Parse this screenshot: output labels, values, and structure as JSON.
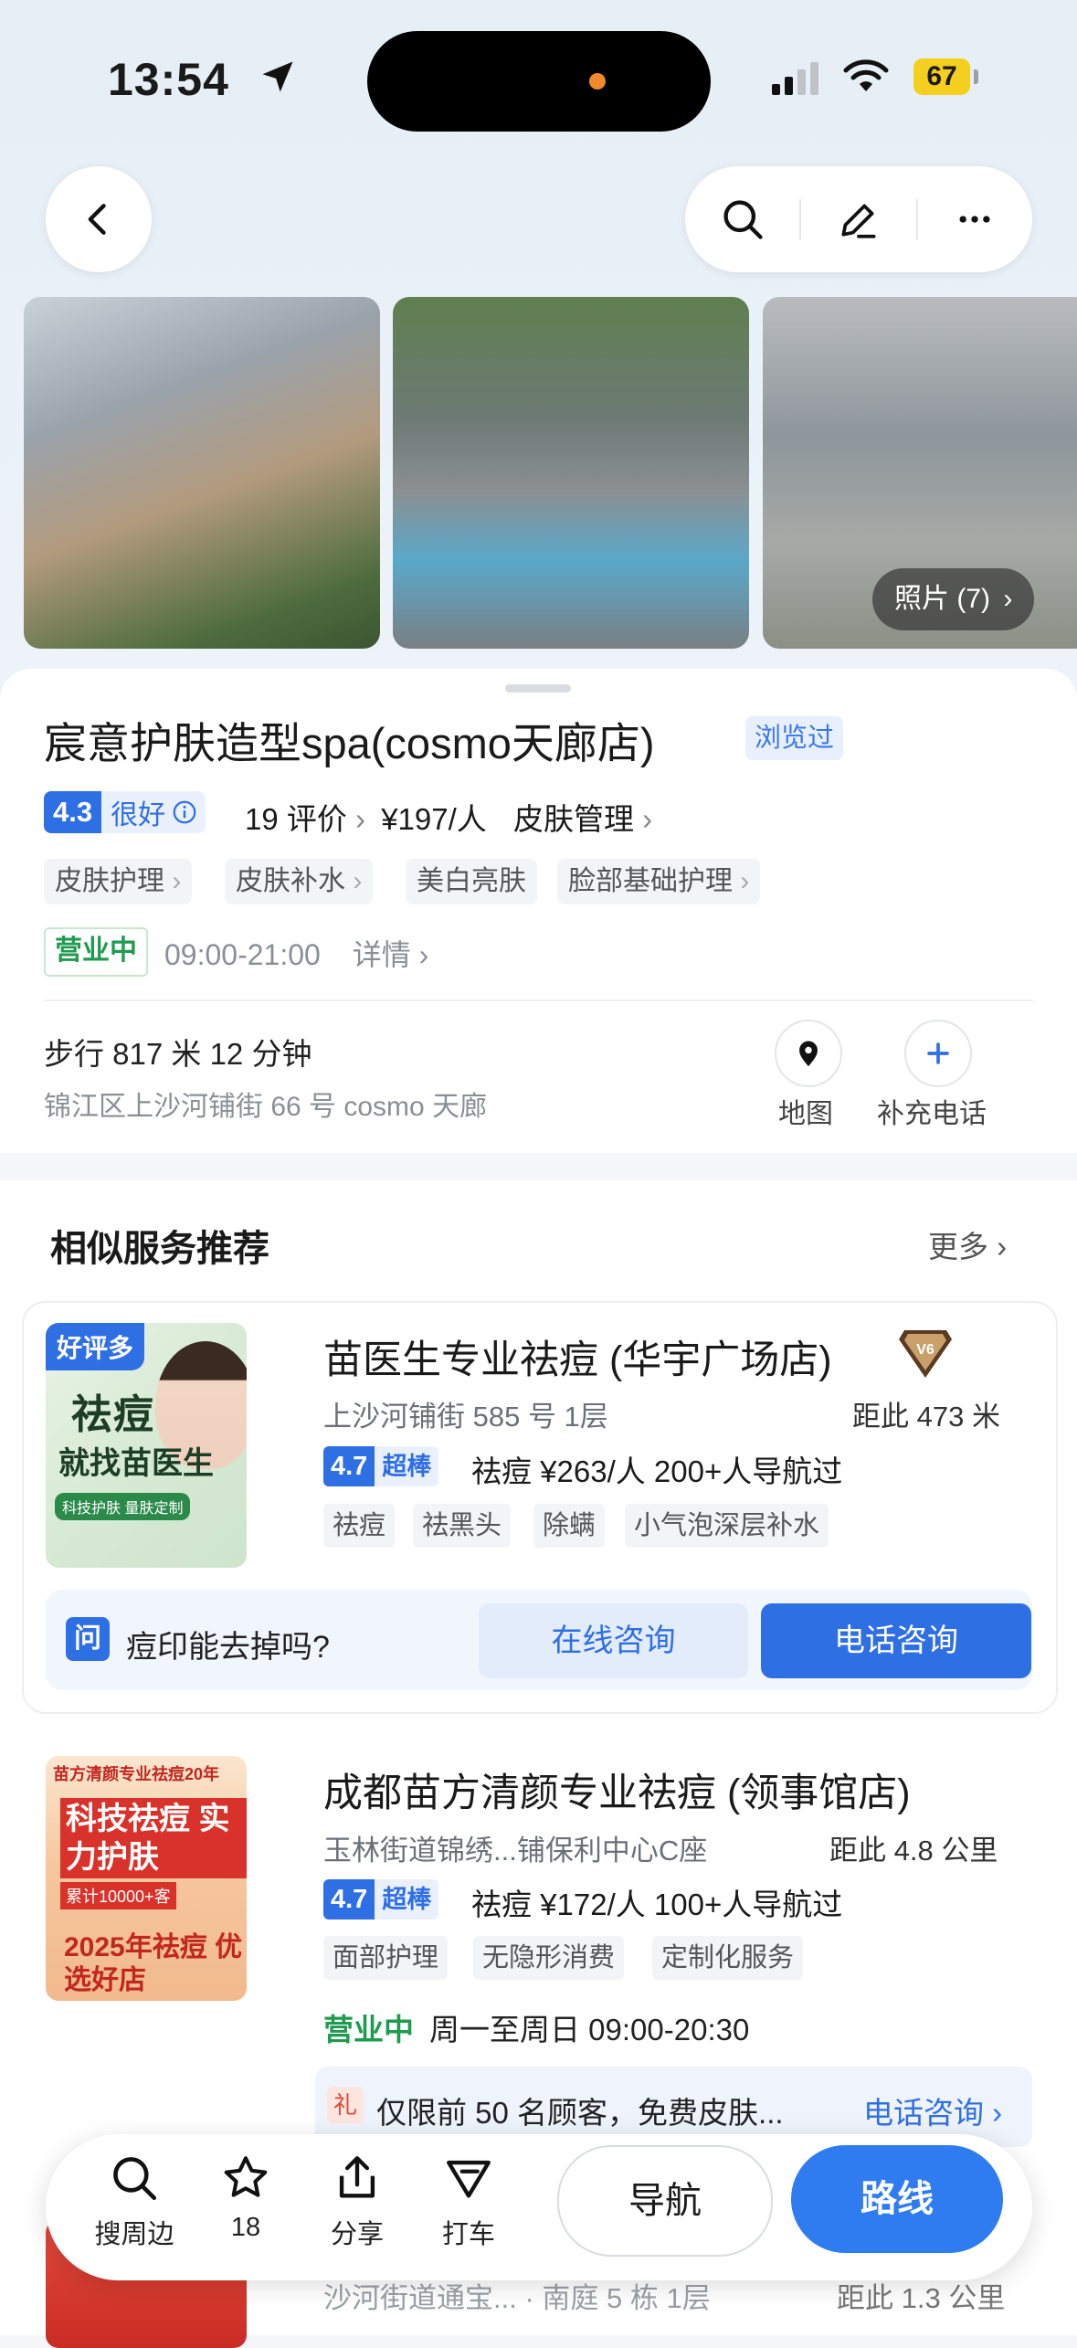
{
  "status_bar": {
    "time": "13:54",
    "battery": "67"
  },
  "photos": {
    "count_label": "照片 (7)"
  },
  "place": {
    "title": "宸意护肤造型spa(cosmo天廊店)",
    "viewed_badge": "浏览过",
    "rating": "4.3",
    "rating_label": "很好",
    "reviews": "19 评价",
    "price": "¥197/人",
    "category": "皮肤管理",
    "tags": [
      "皮肤护理",
      "皮肤补水",
      "美白亮肤",
      "脸部基础护理"
    ],
    "open_status": "营业中",
    "hours": "09:00-21:00",
    "details_link": "详情",
    "walk_info": "步行 817 米 12 分钟",
    "address": "锦江区上沙河铺街 66 号 cosmo 天廊",
    "map_label": "地图",
    "add_phone_label": "补充电话"
  },
  "similar": {
    "section_title": "相似服务推荐",
    "more_label": "更多",
    "items": [
      {
        "badge": "好评多",
        "thumb_line1": "祛痘",
        "thumb_line2": "就找苗医生",
        "thumb_line3": "科技护肤  量肤定制",
        "name": "苗医生专业祛痘 (华宇广场店)",
        "vip": "V6",
        "address": "上沙河铺街 585 号 1层",
        "distance": "距此 473 米",
        "rating": "4.7",
        "rating_label": "超棒",
        "meta": "祛痘  ¥263/人  200+人导航过",
        "tags": [
          "祛痘",
          "祛黑头",
          "除螨",
          "小气泡深层补水"
        ],
        "qa_icon": "问",
        "qa_question": "痘印能去掉吗?",
        "qa_online": "在线咨询",
        "qa_phone": "电话咨询"
      },
      {
        "thumb_line1": "苗方清颜专业祛痘20年",
        "thumb_line2": "科技祛痘 实力护肤",
        "thumb_line3": "累计10000+客",
        "thumb_line4": "2025年祛痘 优选好店",
        "name": "成都苗方清颜专业祛痘 (领事馆店)",
        "address": "玉林街道锦绣...铺保利中心C座",
        "distance": "距此 4.8 公里",
        "rating": "4.7",
        "rating_label": "超棒",
        "meta": "祛痘  ¥172/人  100+人导航过",
        "tags": [
          "面部护理",
          "无隐形消费",
          "定制化服务"
        ],
        "open_status": "营业中",
        "hours": "周一至周日 09:00-20:30",
        "promo_icon": "礼",
        "promo_text": "仅限前 50 名顾客，免费皮肤...",
        "promo_link": "电话咨询"
      },
      {
        "address": "沙河街道通宝... · 南庭 5 栋 1层",
        "distance": "距此 1.3 公里"
      }
    ]
  },
  "bottom_bar": {
    "nearby_label": "搜周边",
    "favorites_count": "18",
    "share_label": "分享",
    "taxi_label": "打车",
    "navigate_label": "导航",
    "route_label": "路线"
  }
}
